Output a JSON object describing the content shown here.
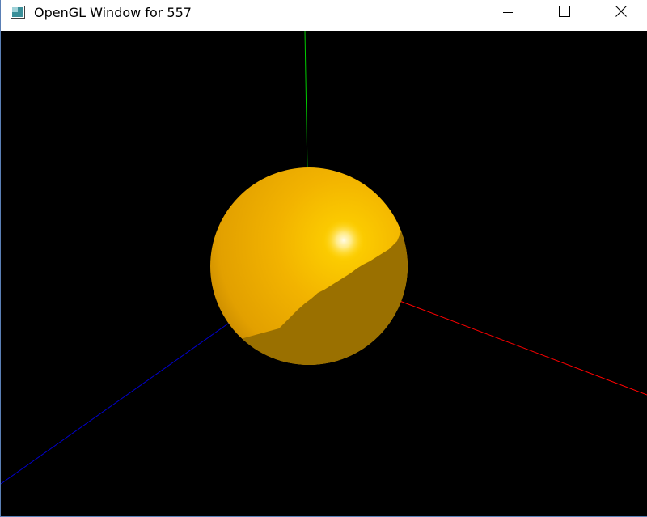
{
  "window": {
    "title": "OpenGL Window for 557",
    "controls": {
      "minimize": "minimize-icon",
      "maximize": "maximize-icon",
      "close": "close-icon"
    }
  },
  "scene": {
    "background": "#000000",
    "axes": {
      "x_color": "#ff0000",
      "y_color": "#00cc00",
      "z_color": "#0000cc"
    },
    "sphere": {
      "lit_color": "#ffc000",
      "mid_color": "#e6a400",
      "shadow_color": "#9a7000",
      "highlight_color": "#fff8d0"
    }
  }
}
